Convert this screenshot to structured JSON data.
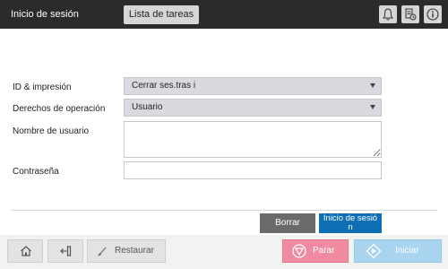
{
  "header": {
    "title": "Inicio de sesión",
    "task_list_label": "Lista de tareas",
    "icons": [
      "bell-icon",
      "device-status-icon",
      "info-icon"
    ]
  },
  "form": {
    "id_print_label": "ID & impresión",
    "id_print_value": "Cerrar ses.tras i",
    "rights_label": "Derechos de operación",
    "rights_value": "Usuario",
    "username_label": "Nombre de usuario",
    "username_value": "",
    "password_label": "Contraseña",
    "password_value": ""
  },
  "actions": {
    "clear_label": "Borrar",
    "login_label_line1": "Inicio de sesió",
    "login_label_line2": "n"
  },
  "footer": {
    "reset_label": "Restaurar",
    "stop_label": "Parar",
    "start_label": "Iniciar"
  },
  "colors": {
    "header_bg": "#2b2b2b",
    "select_bg": "#dcd8e0",
    "login_button": "#0e6fb5",
    "clear_button": "#6a6a6a",
    "stop_button": "#f08aa0",
    "start_button": "#a8d4f0"
  }
}
